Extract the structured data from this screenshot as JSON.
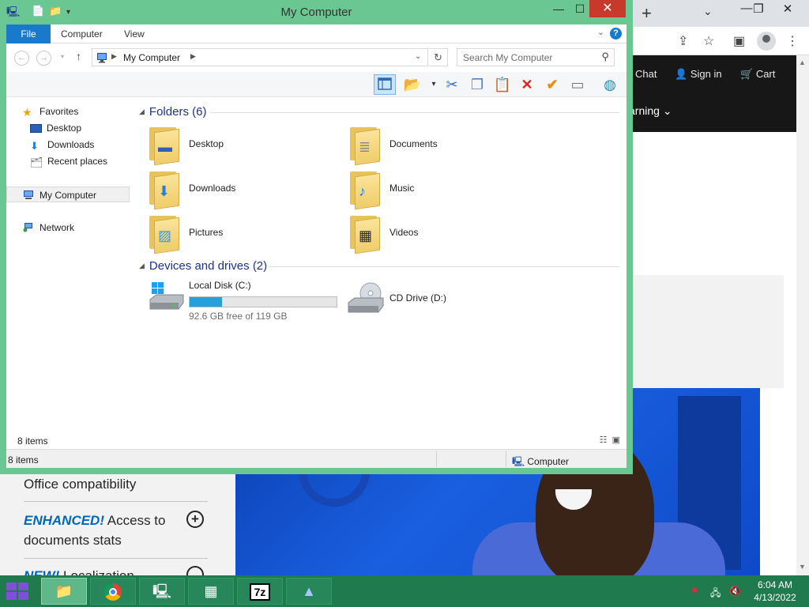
{
  "window": {
    "title": "My Computer",
    "controls": {
      "minimize": "—",
      "maximize": "☐",
      "close": "✕"
    }
  },
  "ribbon": {
    "tabs": [
      "File",
      "Computer",
      "View"
    ],
    "help": "?"
  },
  "address": {
    "path": "My Computer",
    "search_placeholder": "Search My Computer"
  },
  "navigation": {
    "favorites": "Favorites",
    "desktop": "Desktop",
    "downloads": "Downloads",
    "recent": "Recent places",
    "my_computer": "My Computer",
    "network": "Network"
  },
  "folders": {
    "heading": "Folders (6)",
    "items": [
      "Desktop",
      "Documents",
      "Downloads",
      "Music",
      "Pictures",
      "Videos"
    ]
  },
  "drives": {
    "heading": "Devices and drives (2)",
    "local_disk": {
      "name": "Local Disk (C:)",
      "free_text": "92.6 GB free of 119 GB",
      "used_fraction": 0.22
    },
    "cd_drive": {
      "name": "CD Drive (D:)"
    }
  },
  "status": {
    "items_inner": "8 items",
    "items": "8 items",
    "location": "Computer"
  },
  "browser": {
    "nav_chat": "Chat",
    "nav_signin": "Sign in",
    "nav_cart": "Cart",
    "nav_learning": "arning",
    "feature_1": "Office compatibility",
    "feature_2_em": "ENHANCED!",
    "feature_2_rest": " Access to",
    "feature_2_line2": "documents stats",
    "feature_3_em": "NEW!",
    "feature_3_rest": " Localization"
  },
  "taskbar": {
    "time": "6:04 AM",
    "date": "4/13/2022"
  },
  "colors": {
    "window_frame": "#6bc792",
    "accent": "#1979ca",
    "close_button": "#c7392b",
    "taskbar": "#1f7a4d",
    "drive_fill": "#26a0da"
  }
}
